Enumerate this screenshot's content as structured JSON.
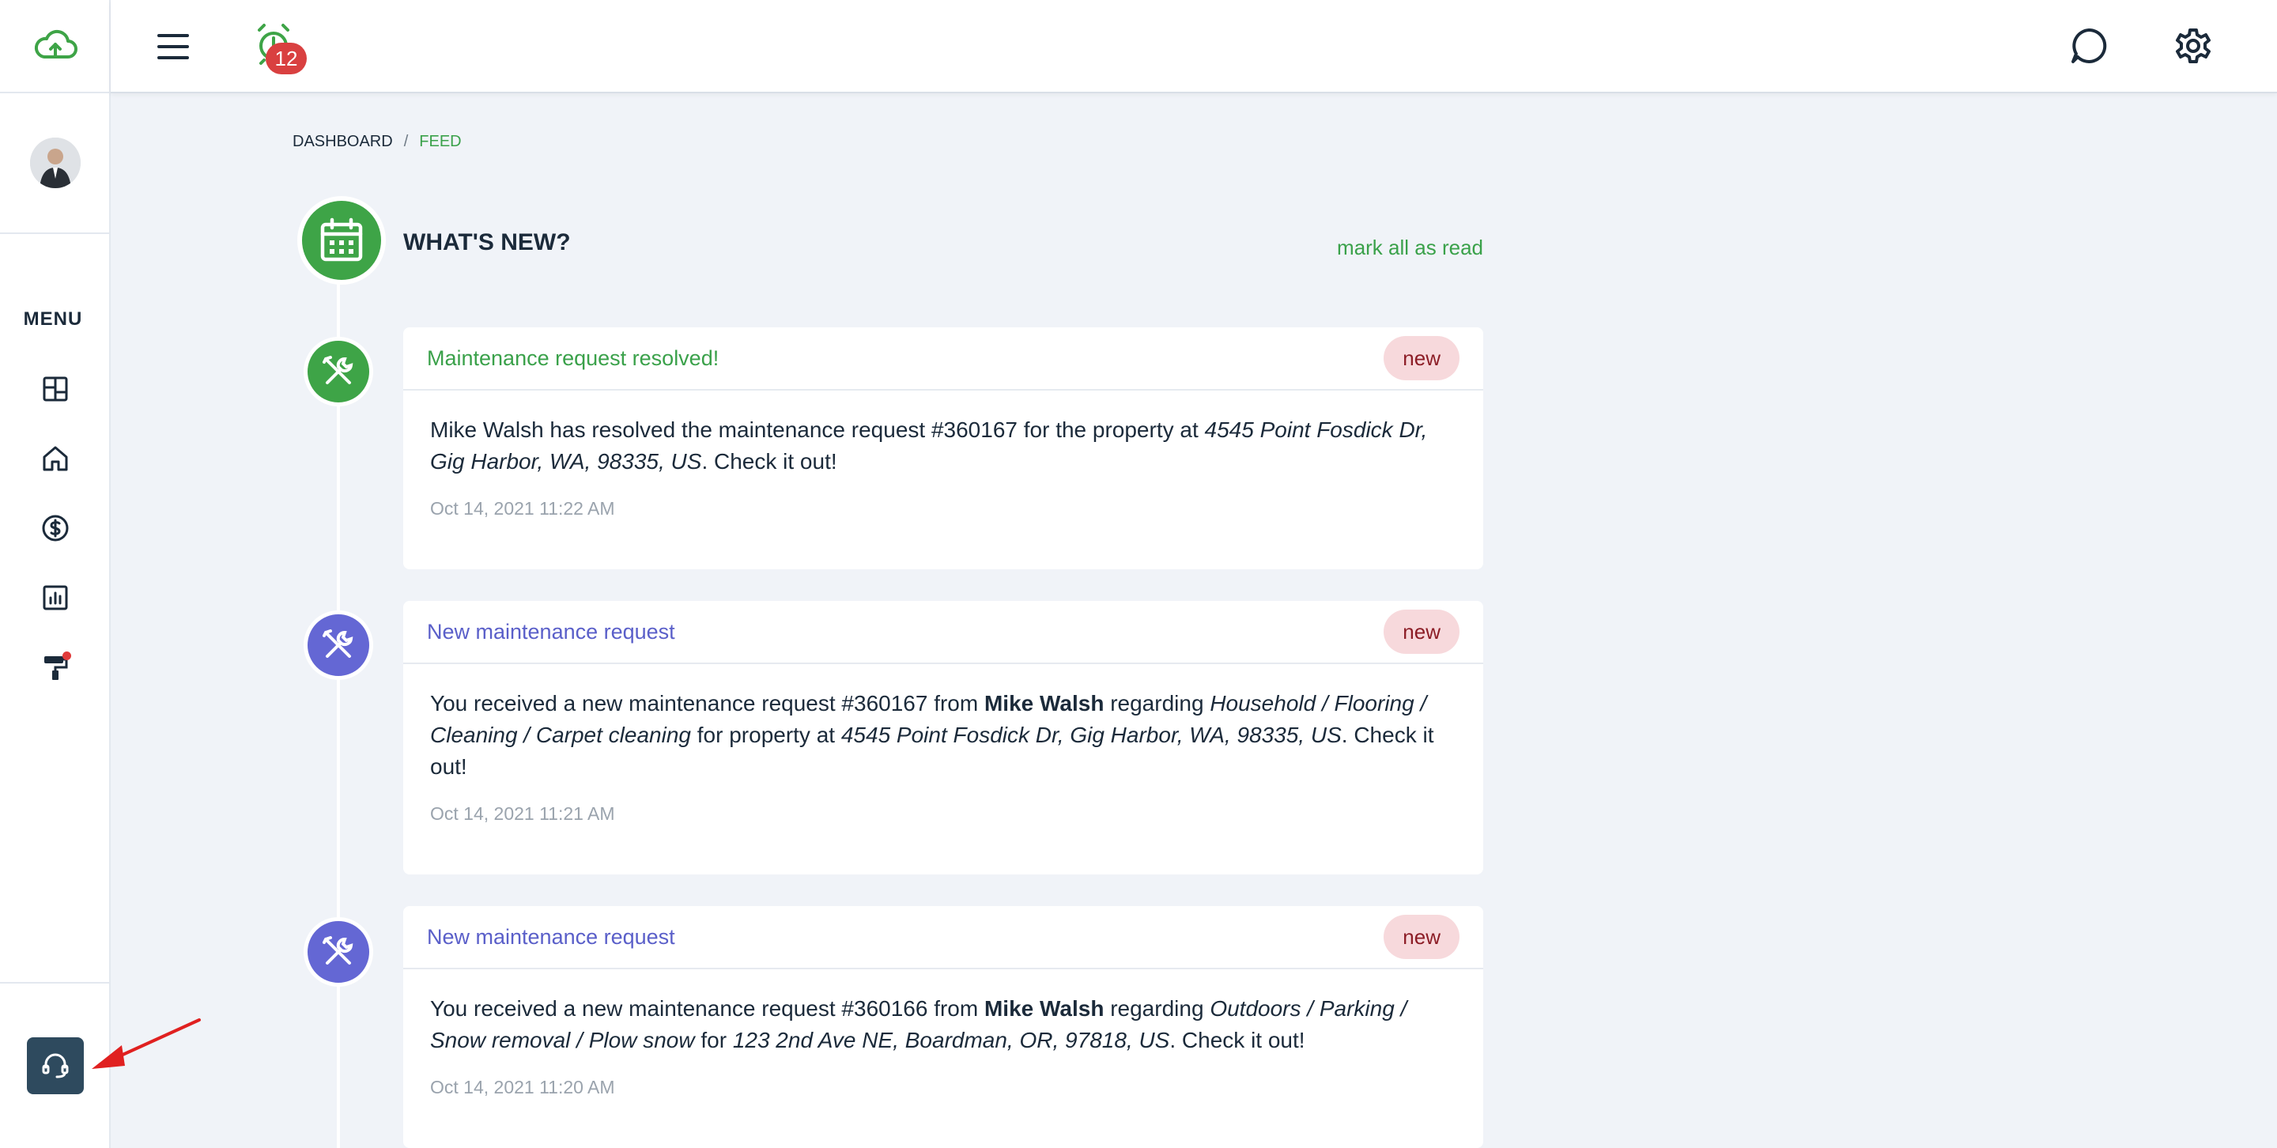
{
  "topbar": {
    "alarm_count": "12"
  },
  "sidebar": {
    "menu_title": "MENU",
    "items": [
      {
        "icon": "dashboard-icon"
      },
      {
        "icon": "home-icon"
      },
      {
        "icon": "dollar-icon"
      },
      {
        "icon": "chart-icon"
      },
      {
        "icon": "paint-roller-icon"
      }
    ]
  },
  "breadcrumb": {
    "root": "DASHBOARD",
    "separator": "/",
    "current": "FEED"
  },
  "feed": {
    "title": "WHAT'S NEW?",
    "mark_all_label": "mark all as read",
    "items": [
      {
        "title": "Maintenance request resolved!",
        "badge": "new",
        "body": {
          "p1": "Mike Walsh has resolved the maintenance request #360167 for the property at ",
          "address": "4545 Point Fosdick Dr, Gig Harbor, WA, 98335, US",
          "p2": ". Check it out!"
        },
        "time": "Oct 14, 2021 11:22 AM"
      },
      {
        "title": "New maintenance request",
        "badge": "new",
        "body": {
          "p1": "You received a new maintenance request #360167 from ",
          "name": "Mike Walsh",
          "p2": " regarding ",
          "category": "Household / Flooring / Cleaning / Carpet cleaning",
          "p3": " for property at ",
          "address": "4545 Point Fosdick Dr, Gig Harbor, WA, 98335, US",
          "p4": ". Check it out!"
        },
        "time": "Oct 14, 2021 11:21 AM"
      },
      {
        "title": "New maintenance request",
        "badge": "new",
        "body": {
          "p1": "You received a new maintenance request #360166 from ",
          "name": "Mike Walsh",
          "p2": " regarding ",
          "category": "Outdoors / Parking / Snow removal / Plow snow",
          "p3": " for ",
          "address": "123 2nd Ave NE, Boardman, OR, 97818, US",
          "p4": ". Check it out!"
        },
        "time": "Oct 14, 2021 11:20 AM"
      }
    ]
  },
  "colors": {
    "brand_green": "#3ea447",
    "purple": "#6467d4",
    "badge_bg": "#f7d9dc",
    "support_btn": "#2e4a5e"
  }
}
